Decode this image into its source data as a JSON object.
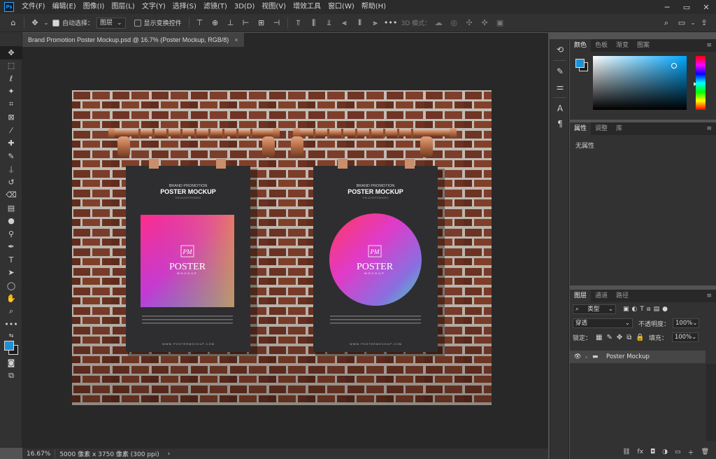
{
  "menu": {
    "items": [
      "文件(F)",
      "编辑(E)",
      "图像(I)",
      "图层(L)",
      "文字(Y)",
      "选择(S)",
      "滤镜(T)",
      "3D(D)",
      "视图(V)",
      "增效工具",
      "窗口(W)",
      "帮助(H)"
    ]
  },
  "app": {
    "logo": "Ps"
  },
  "options": {
    "auto_select_label": "自动选择：",
    "auto_select_value": "图层",
    "show_transform_label": "显示变换控件",
    "mode_3d_label": "3D 模式："
  },
  "document": {
    "tab_title": "Brand Promotion Poster Mockup.psd @ 16.7% (Poster Mockup, RGB/8)",
    "close": "×"
  },
  "poster_left": {
    "kicker": "BRAND PROMOTION",
    "title": "POSTER MOCKUP",
    "sub": "THE ADVERTISEMENT",
    "mono": "PM",
    "logo_word": "POSTER",
    "logo_sub": "MOCKUP",
    "url": "W W W . P O S T E R M O C K U P . C O M"
  },
  "poster_right": {
    "kicker": "BRAND PROMOTION",
    "title": "POSTER MOCKUP",
    "sub": "THE ADVERTISEMENT",
    "mono": "PM",
    "logo_word": "POSTER",
    "logo_sub": "MOCKUP",
    "url": "W W W . P O S T E R M O C K U P . C O M"
  },
  "status": {
    "zoom": "16.67%",
    "doc_info": "5000 像素 x 3750 像素 (300 ppi)",
    "arrow": "›"
  },
  "color_panel": {
    "tabs": [
      "颜色",
      "色板",
      "渐变",
      "图案"
    ],
    "fg_color": "#1f8fd6",
    "bg_color": "#1b1b1b",
    "hue": "#00a8ff"
  },
  "properties_panel": {
    "tabs": [
      "属性",
      "调整",
      "库"
    ],
    "empty_label": "无属性"
  },
  "layers_panel": {
    "tabs": [
      "图层",
      "通道",
      "路径"
    ],
    "filter_label": "类型",
    "blend_mode": "穿透",
    "opacity_label": "不透明度：",
    "opacity_value": "100%",
    "lock_label": "锁定：",
    "fill_label": "填充：",
    "fill_value": "100%",
    "layer_name": "Poster Mockup",
    "bottom_icons": [
      "⛓",
      "fx",
      "◘",
      "◑",
      "▭",
      "＋",
      "🗑"
    ]
  },
  "colors": {
    "accent": "#31a8ff",
    "brick": "#7a3a28",
    "poster": "#2e2e30"
  }
}
